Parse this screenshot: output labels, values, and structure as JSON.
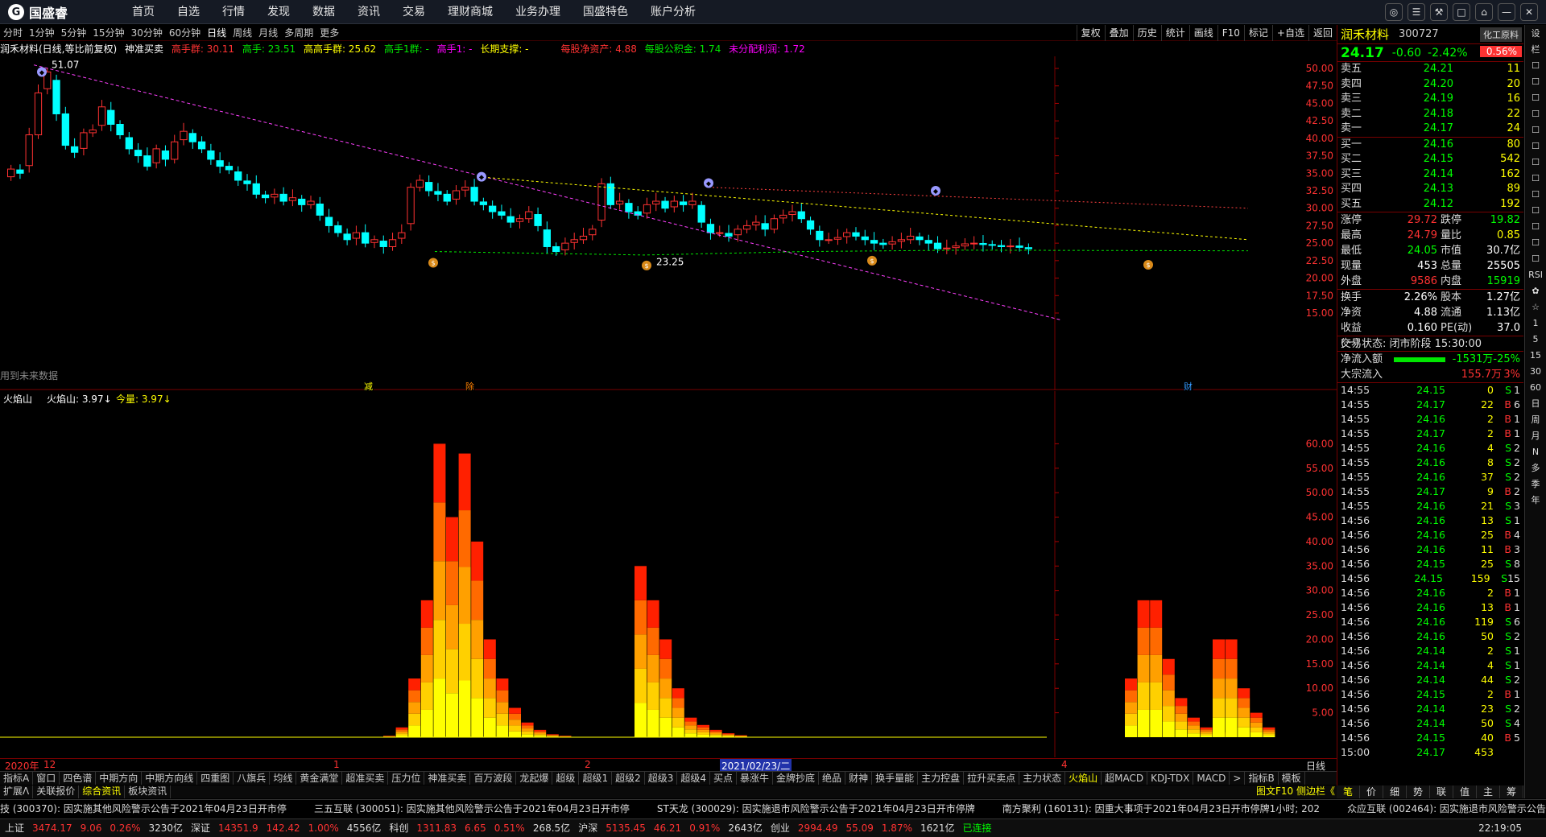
{
  "app": {
    "logo": "国盛睿",
    "logo_icon": "G"
  },
  "nav": [
    "首页",
    "自选",
    "行情",
    "发现",
    "数据",
    "资讯",
    "交易",
    "理财商城",
    "业务办理",
    "国盛特色",
    "账户分析"
  ],
  "window_buttons": [
    "◎",
    "☰",
    "⚒",
    "□",
    "⌂",
    "—",
    "✕"
  ],
  "period_tabs": [
    "分时",
    "1分钟",
    "5分钟",
    "15分钟",
    "30分钟",
    "60分钟",
    "日线",
    "周线",
    "月线",
    "多周期",
    "更多"
  ],
  "active_period": "日线",
  "right_tools": [
    "复权",
    "叠加",
    "历史",
    "统计",
    "画线",
    "F10",
    "标记",
    "+自选",
    "返回"
  ],
  "info": {
    "name": "润禾材料(日线,等比前复权)",
    "ind": "神准买卖",
    "f1": "高手群: 30.11",
    "f2": "高手: 23.51",
    "f3": "高高手群: 25.62",
    "f4": "高手1群: -",
    "f5": "高手1: -",
    "f6": "长期支撑: -",
    "f7": "每股净资产: 4.88",
    "f8": "每股公积金: 1.74",
    "f9": "未分配利润: 1.72"
  },
  "main_chart": {
    "price_ticks": [
      "50.00",
      "47.50",
      "45.00",
      "42.50",
      "40.00",
      "37.50",
      "35.00",
      "32.50",
      "30.00",
      "27.50",
      "25.00",
      "22.50",
      "20.00",
      "17.50",
      "15.00"
    ],
    "high_label": "51.07",
    "low_label": "23.25",
    "future_note": "用到未来数据",
    "markers": [
      "减",
      "除",
      "财"
    ]
  },
  "sub_chart": {
    "title": "火焰山",
    "line": "火焰山: 3.97↓",
    "line2": "今量: 3.97↓",
    "ticks": [
      "60.00",
      "55.00",
      "50.00",
      "45.00",
      "40.00",
      "35.00",
      "30.00",
      "25.00",
      "20.00",
      "15.00",
      "10.00",
      "5.00"
    ]
  },
  "dates": {
    "d0": "2020年",
    "d1": "12",
    "d2": "1",
    "d3": "2",
    "d4": "2021/02/23/二",
    "d5": "4",
    "mode": "日线"
  },
  "indicator_tabs": [
    "指标A",
    "窗口",
    "四色谱",
    "中期方向",
    "中期方向线",
    "四重图",
    "八旗兵",
    "均线",
    "黄金满堂",
    "超准买卖",
    "压力位",
    "神准买卖",
    "百万波段",
    "龙起爆",
    "超级",
    "超级1",
    "超级2",
    "超级3",
    "超级4",
    "买点",
    "暴涨牛",
    "金牌抄底",
    "绝品",
    "财神",
    "换手量能",
    "主力控盘",
    "拉升买卖点",
    "主力状态",
    "火焰山",
    "超MACD",
    "KDJ-TDX",
    "MACD",
    ">",
    "指标B",
    "模板"
  ],
  "active_indicator": "火焰山",
  "bottom_tabs": [
    "扩展ᐱ",
    "关联报价",
    "综合资讯",
    "板块资讯"
  ],
  "bottom_right": "图文F10 侧边栏《",
  "right_panel": {
    "name": "润禾材料",
    "code": "300727",
    "industry": "化工原料",
    "price": "24.17",
    "change": "-0.60",
    "pct": "-2.42%",
    "box": "0.56%",
    "sells": [
      [
        "卖五",
        "24.21",
        "11"
      ],
      [
        "卖四",
        "24.20",
        "20"
      ],
      [
        "卖三",
        "24.19",
        "16"
      ],
      [
        "卖二",
        "24.18",
        "22"
      ],
      [
        "卖一",
        "24.17",
        "24"
      ]
    ],
    "buys": [
      [
        "买一",
        "24.16",
        "80"
      ],
      [
        "买二",
        "24.15",
        "542"
      ],
      [
        "买三",
        "24.14",
        "162"
      ],
      [
        "买四",
        "24.13",
        "89"
      ],
      [
        "买五",
        "24.12",
        "192"
      ]
    ],
    "stats": [
      [
        "涨停",
        "29.72",
        "跌停",
        "19.82"
      ],
      [
        "最高",
        "24.79",
        "量比",
        "0.85"
      ],
      [
        "最低",
        "24.05",
        "市值",
        "30.7亿"
      ],
      [
        "现量",
        "453",
        "总量",
        "25505"
      ],
      [
        "外盘",
        "9586",
        "内盘",
        "15919"
      ]
    ],
    "stats2": [
      [
        "换手",
        "2.26%",
        "股本",
        "1.27亿"
      ],
      [
        "净资",
        "4.88",
        "流通",
        "1.13亿"
      ],
      [
        "收益(一)",
        "0.160",
        "PE(动)",
        "37.0"
      ]
    ],
    "trade_status": "交易状态: 闭市阶段 15:30:00",
    "flow1": [
      "净流入额",
      "-1531万",
      "-25%"
    ],
    "flow2": [
      "大宗流入",
      "155.7万",
      "3%"
    ],
    "trades": [
      [
        "14:55",
        "24.15",
        "0",
        "S",
        "1"
      ],
      [
        "14:55",
        "24.17",
        "22",
        "B",
        "6"
      ],
      [
        "14:55",
        "24.16",
        "2",
        "B",
        "1"
      ],
      [
        "14:55",
        "24.17",
        "2",
        "B",
        "1"
      ],
      [
        "14:55",
        "24.16",
        "4",
        "S",
        "2"
      ],
      [
        "14:55",
        "24.16",
        "8",
        "S",
        "2"
      ],
      [
        "14:55",
        "24.16",
        "37",
        "S",
        "2"
      ],
      [
        "14:55",
        "24.17",
        "9",
        "B",
        "2"
      ],
      [
        "14:55",
        "24.16",
        "21",
        "S",
        "3"
      ],
      [
        "14:56",
        "24.16",
        "13",
        "S",
        "1"
      ],
      [
        "14:56",
        "24.16",
        "25",
        "B",
        "4"
      ],
      [
        "14:56",
        "24.16",
        "11",
        "B",
        "3"
      ],
      [
        "14:56",
        "24.15",
        "25",
        "S",
        "8"
      ],
      [
        "14:56",
        "24.15",
        "159",
        "S",
        "15"
      ],
      [
        "14:56",
        "24.16",
        "2",
        "B",
        "1"
      ],
      [
        "14:56",
        "24.16",
        "13",
        "B",
        "1"
      ],
      [
        "14:56",
        "24.16",
        "119",
        "S",
        "6"
      ],
      [
        "14:56",
        "24.16",
        "50",
        "S",
        "2"
      ],
      [
        "14:56",
        "24.14",
        "2",
        "S",
        "1"
      ],
      [
        "14:56",
        "24.14",
        "4",
        "S",
        "1"
      ],
      [
        "14:56",
        "24.14",
        "44",
        "S",
        "2"
      ],
      [
        "14:56",
        "24.15",
        "2",
        "B",
        "1"
      ],
      [
        "14:56",
        "24.14",
        "23",
        "S",
        "2"
      ],
      [
        "14:56",
        "24.14",
        "50",
        "S",
        "4"
      ],
      [
        "14:56",
        "24.15",
        "40",
        "B",
        "5"
      ],
      [
        "15:00",
        "24.17",
        "453",
        "",
        ""
      ]
    ],
    "tabs": [
      "笔",
      "价",
      "细",
      "势",
      "联",
      "值",
      "主",
      "筹"
    ]
  },
  "side_strip": [
    "设",
    "栏",
    "☐",
    "☐",
    "☐",
    "☐",
    "☐",
    "☐",
    "☐",
    "☐",
    "☐",
    "☐",
    "☐",
    "☐",
    "☐",
    "RSI",
    "✿",
    "☆",
    "1",
    "5",
    "15",
    "30",
    "60",
    "日",
    "周",
    "月",
    "N",
    "多",
    "季",
    "年"
  ],
  "ticker": [
    "技 (300370): 因实施其他风险警示公告于2021年04月23日开市停",
    "三五互联 (300051): 因实施其他风险警示公告于2021年04月23日开市停",
    "ST天龙 (300029): 因实施退市风险警示公告于2021年04月23日开市停牌",
    "南方聚利 (160131): 因重大事项于2021年04月23日开市停牌1小时; 202",
    "众应互联 (002464): 因实施退市风险警示公告于2021年"
  ],
  "status": {
    "sh_name": "上证",
    "sh": "3474.17",
    "sh_c": "9.06",
    "sh_p": "0.26%",
    "sh_v": "3230亿",
    "sz_name": "深证",
    "sz": "14351.9",
    "sz_c": "142.42",
    "sz_p": "1.00%",
    "sz_v": "4556亿",
    "kc_name": "科创",
    "kc": "1311.83",
    "kc_c": "6.65",
    "kc_p": "0.51%",
    "kc_v": "268.5亿",
    "hs_name": "沪深",
    "hs": "5135.45",
    "hs_c": "46.21",
    "hs_p": "0.91%",
    "hs_v": "2643亿",
    "cy_name": "创业",
    "cy": "2994.49",
    "cy_c": "55.09",
    "cy_p": "1.87%",
    "cy_v": "1621亿",
    "conn": "已连接",
    "time": "22:19:05"
  }
}
